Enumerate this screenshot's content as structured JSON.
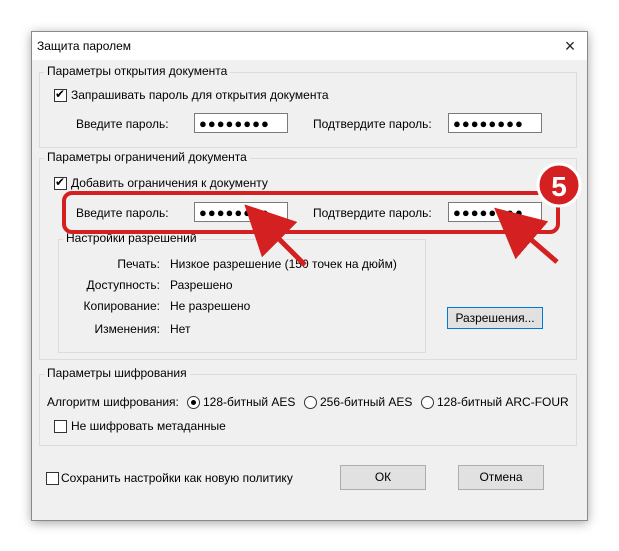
{
  "window": {
    "title": "Защита паролем",
    "close_icon": "×"
  },
  "open_group": {
    "legend": "Параметры открытия документа",
    "checkbox_label": "Запрашивать пароль для открытия документа",
    "checked": true,
    "password_label": "Введите пароль:",
    "password_value": "●●●●●●●●",
    "confirm_label": "Подтвердите пароль:",
    "confirm_value": "●●●●●●●●"
  },
  "restrict_group": {
    "legend": "Параметры ограничений документа",
    "checkbox_label": "Добавить ограничения к документу",
    "checked": true,
    "password_label": "Введите пароль:",
    "password_value": "●●●●●●●●",
    "confirm_label": "Подтвердите пароль:",
    "confirm_value": "●●●●●●●●",
    "permissions": {
      "legend": "Настройки разрешений",
      "rows": [
        {
          "name": "Печать:",
          "value": "Низкое разрешение (150 точек на дюйм)"
        },
        {
          "name": "Доступность:",
          "value": "Разрешено"
        },
        {
          "name": "Копирование:",
          "value": "Не разрешено"
        },
        {
          "name": "Изменения:",
          "value": "Нет"
        }
      ]
    },
    "permissions_button": "Разрешения..."
  },
  "encryption_group": {
    "legend": "Параметры шифрования",
    "algorithm_label": "Алгоритм шифрования:",
    "options": [
      "128-битный AES",
      "256-битный AES",
      "128-битный ARC-FOUR"
    ],
    "selected_index": 0,
    "no_metadata_label": "Не шифровать метаданные",
    "no_metadata_checked": false
  },
  "footer": {
    "save_policy_label": "Сохранить настройки как новую политику",
    "save_policy_checked": false,
    "ok_label": "ОК",
    "cancel_label": "Отмена"
  },
  "annotation": {
    "step_number": "5",
    "color": "#d42020"
  }
}
